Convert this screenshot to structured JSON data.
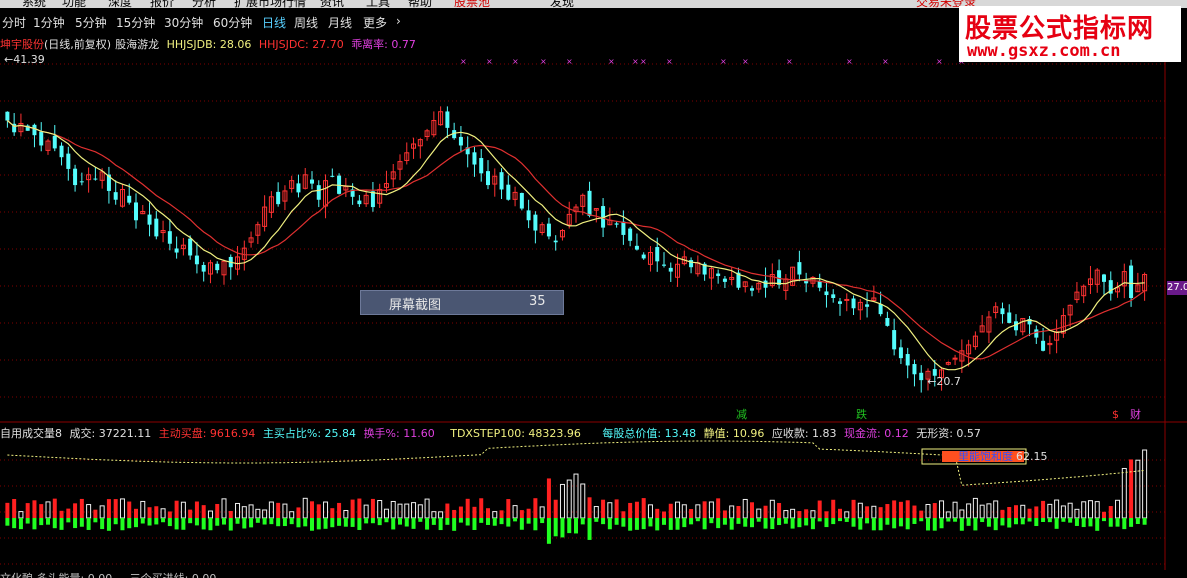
{
  "menubar": {
    "items": [
      "系统",
      "功能",
      "深度",
      "报价",
      "分析",
      "扩展市场行情",
      "资讯",
      "工具",
      "帮助",
      "股票池",
      "发现",
      "交易未登录"
    ],
    "highlight_color": "#d00000"
  },
  "periods": {
    "items": [
      "分时",
      "1分钟",
      "5分钟",
      "15分钟",
      "30分钟",
      "60分钟",
      "日线",
      "周线",
      "月线",
      "更多",
      "›"
    ],
    "active": "日线"
  },
  "logo": {
    "title": "股票公式指标网",
    "url": "www.gsxz.com.cn"
  },
  "stock_info": {
    "name": "坤宇股份",
    "mode": "(日线,前复权)",
    "indicator": "股海游龙",
    "hhjsjdb": "HHJSJDB: 28.06",
    "hhjsjdc": "HHJSJDC: 27.70",
    "deviation": "乖离率: 0.77"
  },
  "price_labels": {
    "high": "41.39",
    "low": "20.70",
    "current": "27.0"
  },
  "signals": {
    "reduce": "减",
    "fall": "跌",
    "dollar": "$",
    "finance": "财"
  },
  "popup": {
    "text": "屏幕截图",
    "count": "35"
  },
  "volume_info": {
    "title": "自用成交量8",
    "volume": "成交: 37221.11",
    "active_buy": "主动买盘: 9616.94",
    "active_buy_pct": "主买占比%: 25.84",
    "turnover": "换手%: 11.60",
    "tdxstep": "TDXSTEP100: 48323.96",
    "total_value": "每股总价值: 13.48",
    "static_value": "静值: 10.96",
    "receivable": "应收款: 1.83",
    "cash_flow": "现金流: 0.12",
    "intangible": "无形资: 0.57"
  },
  "volume_box": {
    "label": "里能饱和度",
    "value": "62.15"
  },
  "bottom_line": "文化酿  多头能量: 0.00    ...   三个买进线: 0.00",
  "colors": {
    "up": "#ff3232",
    "down": "#54fcfc",
    "ma_yellow": "#f0f080",
    "ma_red": "#e03030",
    "vol_up": "#ff2020",
    "vol_down": "#20ff20",
    "grid": "#800000"
  },
  "chart_data": {
    "type": "candlestick",
    "closes": [
      38.6,
      37.8,
      38.4,
      37.9,
      37.6,
      36.9,
      37.2,
      36.7,
      36.1,
      35.3,
      34.2,
      34.4,
      34.9,
      34.6,
      35.1,
      33.8,
      33.2,
      33.9,
      33.0,
      31.8,
      32.4,
      31.5,
      30.7,
      31.1,
      30.2,
      29.6,
      30.1,
      29.4,
      28.8,
      28.3,
      28.9,
      28.4,
      29.0,
      28.6,
      29.3,
      29.9,
      30.6,
      31.5,
      32.7,
      33.4,
      32.9,
      33.8,
      34.5,
      33.7,
      34.9,
      34.3,
      33.2,
      34.5,
      34.8,
      33.6,
      34.1,
      33.4,
      32.9,
      33.5,
      32.7,
      33.9,
      34.3,
      35.1,
      35.8,
      36.4,
      37.0,
      37.3,
      37.9,
      38.6,
      39.2,
      38.1,
      37.4,
      36.9,
      36.3,
      35.6,
      35.0,
      34.2,
      34.8,
      33.9,
      33.2,
      33.7,
      32.6,
      31.8,
      31.1,
      31.5,
      30.7,
      30.3,
      31.1,
      32.2,
      32.7,
      33.5,
      32.1,
      32.6,
      31.3,
      31.8,
      31.5,
      30.8,
      30.4,
      29.8,
      29.2,
      29.6,
      29.0,
      28.7,
      28.3,
      28.8,
      29.3,
      28.6,
      28.9,
      28.1,
      28.5,
      28.0,
      27.6,
      27.9,
      27.2,
      27.6,
      27.0,
      27.5,
      27.2,
      28.1,
      27.4,
      27.8,
      28.6,
      28.1,
      27.5,
      27.9,
      27.2,
      26.7,
      26.5,
      26.1,
      26.4,
      25.8,
      26.2,
      25.9,
      26.5,
      25.4,
      24.6,
      23.0,
      22.4,
      21.9,
      21.3,
      20.9,
      21.5,
      21.2,
      21.6,
      22.1,
      22.4,
      22.9,
      23.3,
      23.9,
      24.6,
      25.2,
      25.9,
      25.4,
      24.8,
      24.3,
      25.1,
      24.7,
      23.8,
      22.9,
      23.4,
      24.2,
      25.3,
      26.0,
      26.9,
      27.3,
      27.8,
      28.4,
      27.6,
      26.8,
      27.2,
      28.3,
      26.5,
      27.4,
      28.1
    ],
    "x": "trading days (dates not printed)",
    "ylim": [
      19.0,
      43.0
    ],
    "high": 41.39,
    "low": 20.7
  }
}
